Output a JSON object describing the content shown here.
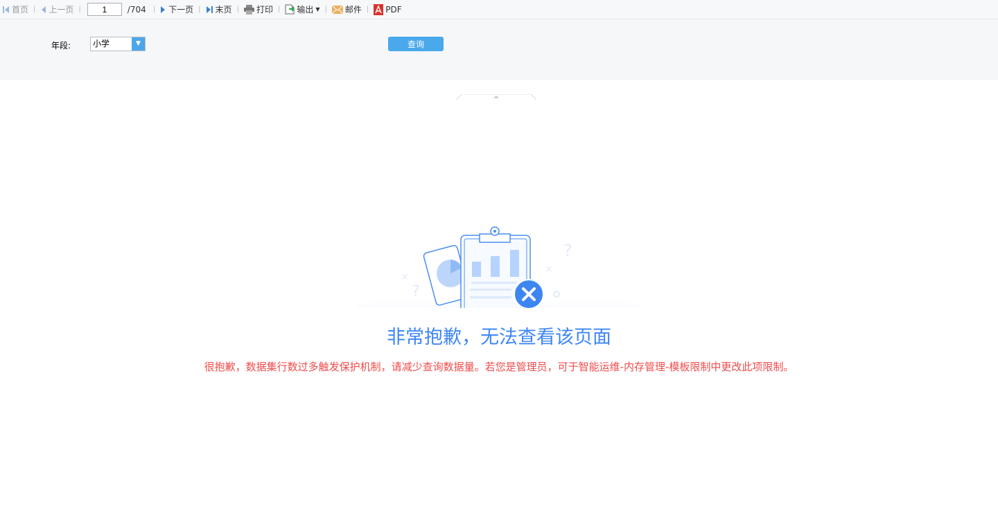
{
  "toolbar": {
    "first": "首页",
    "prev": "上一页",
    "page": "1",
    "total": "/704",
    "next": "下一页",
    "last": "末页",
    "print": "打印",
    "export": "输出",
    "mail": "邮件",
    "pdf": "PDF"
  },
  "params": {
    "grade_label": "年段:",
    "grade_value": "小学",
    "query": "查询"
  },
  "error": {
    "title": "非常抱歉，无法查看该页面",
    "message": "很抱歉，数据集行数过多触发保护机制，请减少查询数据量。若您是管理员，可于智能运维-内存管理-模板限制中更改此项限制。"
  }
}
